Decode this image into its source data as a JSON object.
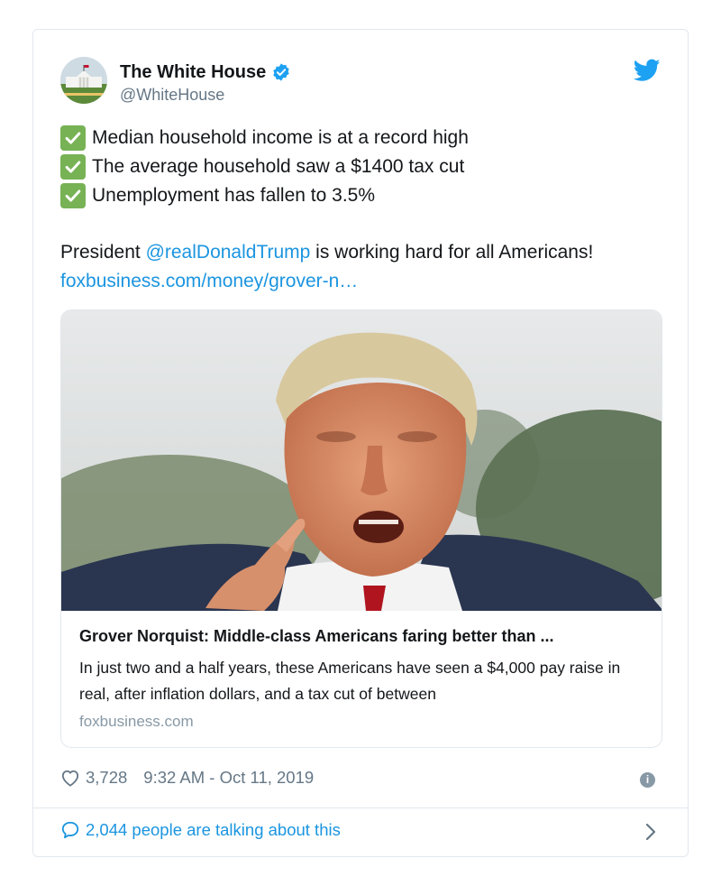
{
  "account": {
    "name": "The White House",
    "handle": "@WhiteHouse"
  },
  "tweet": {
    "bullets": [
      "Median household income is at a record high",
      "The average household saw a $1400 tax cut",
      "Unemployment has fallen to 3.5%"
    ],
    "para_prefix": "President ",
    "mention": "@realDonaldTrump",
    "para_suffix": " is working hard for all Americans!",
    "link": "foxbusiness.com/money/grover-n…"
  },
  "preview": {
    "title": "Grover Norquist: Middle-class Americans faring better than ...",
    "description": "In just two and a half years, these Americans have seen a $4,000 pay raise in real, after inflation dollars, and a tax cut of between",
    "domain": "foxbusiness.com"
  },
  "meta": {
    "likes": "3,728",
    "timestamp": "9:32 AM - Oct 11, 2019"
  },
  "footer": {
    "talking": "2,044 people are talking about this"
  },
  "colors": {
    "link": "#1b95e0",
    "verified": "#1da1f2",
    "check": "#77b255"
  }
}
